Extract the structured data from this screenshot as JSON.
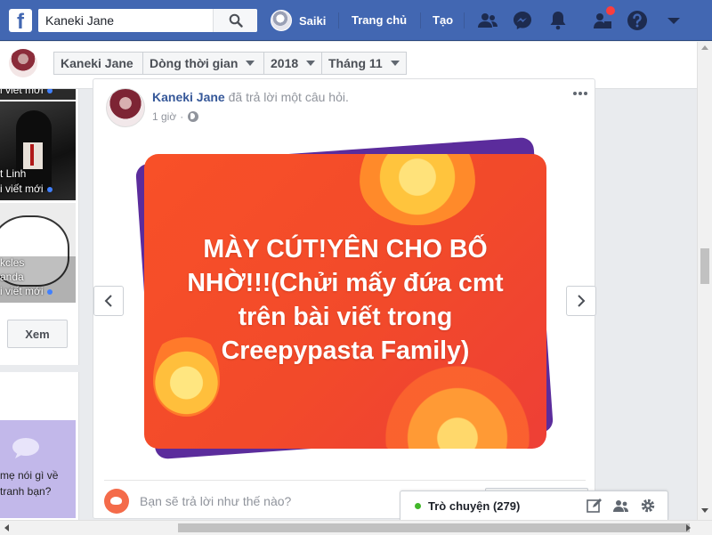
{
  "colors": {
    "brand": "#4267b2",
    "link": "#365899",
    "card_orange": "#f24a2a",
    "card_purple": "#5b2c9c",
    "online": "#42b72a",
    "notif": "#fa3e3e"
  },
  "topbar": {
    "logo_icon": "facebook-f-logo",
    "search_value": "Kaneki Jane",
    "search_icon": "search-icon",
    "profile_name": "Saiki",
    "home_label": "Trang chủ",
    "create_label": "Tạo",
    "icons": [
      "friends-icon",
      "messenger-icon",
      "notifications-icon",
      "quick-help-icon",
      "help-icon",
      "chevron-down-icon"
    ]
  },
  "timeline_bar": {
    "name": "Kaneki Jane",
    "section": "Dòng thời gian",
    "year": "2018",
    "month": "Tháng 11"
  },
  "left_column": {
    "card1_top_caption": "i viết mới",
    "card2_line1": "t Linh",
    "card2_line2": "i viết mới",
    "card3_line1": "kcles",
    "card3_line2": "anda",
    "card3_line3": "i viết mới",
    "view_button": "Xem",
    "purple_line1": "mẹ nói gì về",
    "purple_line2": "tranh bạn?"
  },
  "post": {
    "author": "Kaneki Jane",
    "action": " đã trả lời một câu hỏi.",
    "time": "1 giờ",
    "time_sep": "·",
    "audience_icon": "globe-icon",
    "question_text": "MÀY CÚT!YÊN CHO BỐ NHỜ!!!(Chửi mấy đứa cmt trên bài viết trong Creepypasta Family)",
    "answer_prompt": "Bạn sẽ trả lời như thế nào?"
  },
  "chat": {
    "label": "Trò chuyện (279)",
    "icons": [
      "compose-icon",
      "group-icon",
      "settings-icon"
    ]
  }
}
